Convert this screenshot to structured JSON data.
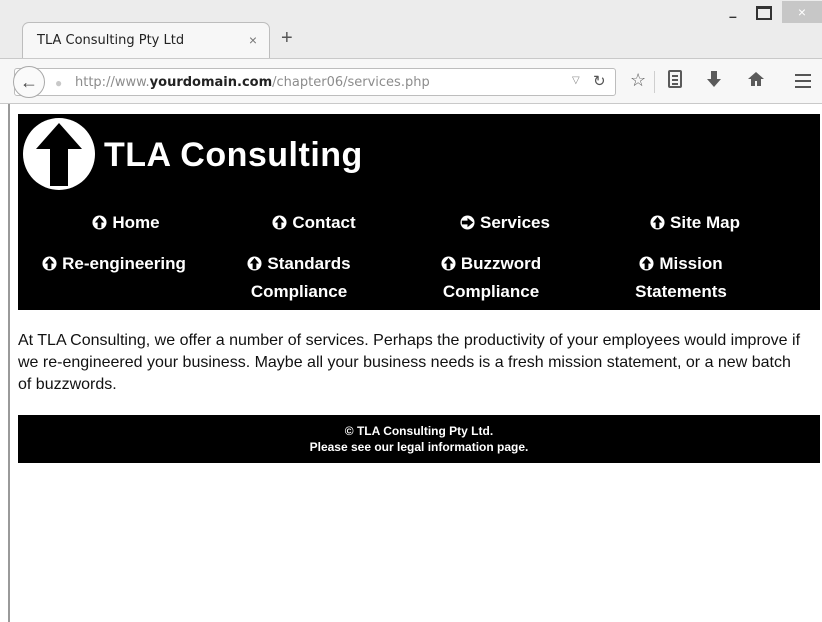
{
  "browser": {
    "tab_title": "TLA Consulting Pty Ltd",
    "tab_close": "×",
    "new_tab": "+",
    "window_controls": {
      "minimize": "–",
      "close": "×"
    },
    "url_prefix": "http://www.",
    "url_domain": "yourdomain.com",
    "url_path": "/chapter06/services.php",
    "icons": [
      "back-arrow-icon",
      "globe-icon",
      "dropdown-icon",
      "reload-icon",
      "star-icon",
      "reading-list-icon",
      "download-icon",
      "home-icon",
      "menu-icon"
    ]
  },
  "site": {
    "title": "TLA Consulting",
    "nav": [
      {
        "label": "Home",
        "icon": "arrow-up"
      },
      {
        "label": "Contact",
        "icon": "arrow-up"
      },
      {
        "label": "Services",
        "icon": "arrow-right"
      },
      {
        "label": "Site Map",
        "icon": "arrow-up"
      },
      {
        "label_line1": "Re-engineering",
        "icon": "arrow-up"
      },
      {
        "label_line1": "Standards",
        "label_line2": "Compliance",
        "icon": "arrow-up"
      },
      {
        "label_line1": "Buzzword",
        "label_line2": "Compliance",
        "icon": "arrow-up"
      },
      {
        "label_line1": "Mission",
        "label_line2": "Statements",
        "icon": "arrow-up"
      }
    ],
    "intro": "At TLA Consulting, we offer a number of services. Perhaps the productivity of your employees would improve if we re-engineered your business. Maybe all your business needs is a fresh mission statement, or a new batch of buzzwords.",
    "footer_line1": "© TLA Consulting Pty Ltd.",
    "footer_line2": "Please see our legal information page."
  },
  "colors": {
    "header_bg": "#000000",
    "header_text": "#ffffff",
    "chrome_bg": "#ececec"
  }
}
